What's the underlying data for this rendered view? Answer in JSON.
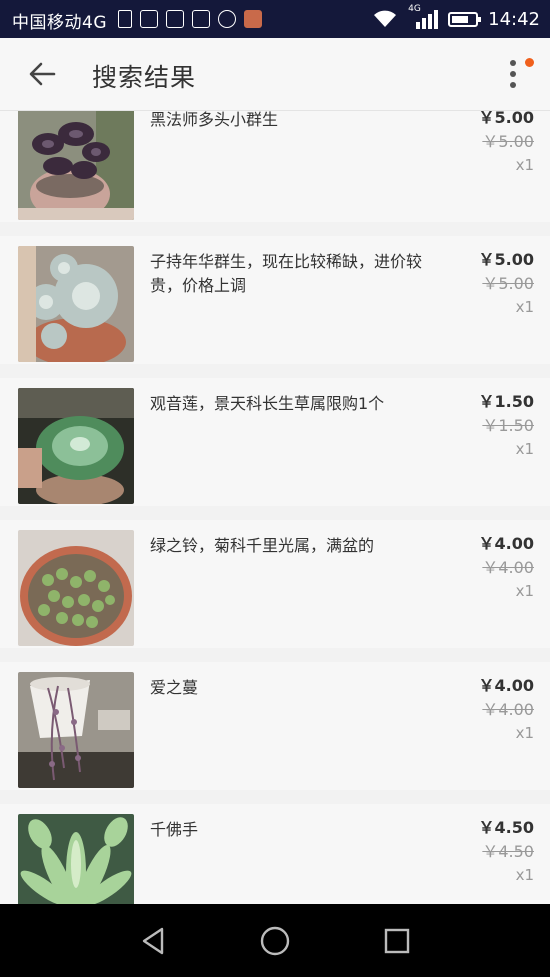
{
  "status_bar": {
    "carrier": "中国移动4G",
    "time": "14:42",
    "network": "4G",
    "icons": [
      "sim-alert-icon",
      "taobao-icon",
      "douguo-icon",
      "douguo-icon",
      "vpn-icon",
      "app-icon"
    ]
  },
  "header": {
    "title": "搜索结果"
  },
  "items": [
    {
      "name": "黑法师多头小群生",
      "price": "￥5.00",
      "original_price": "￥5.00",
      "quantity": "x1",
      "image": "dark-rosette-succulent"
    },
    {
      "name": "子持年华群生，现在比较稀缺，进价较贵，价格上调",
      "price": "￥5.00",
      "original_price": "￥5.00",
      "quantity": "x1",
      "image": "pale-blue-rosette-succulent"
    },
    {
      "name": "观音莲，景天科长生草属限购1个",
      "price": "￥1.50",
      "original_price": "￥1.50",
      "quantity": "x1",
      "image": "green-rosette-succulent"
    },
    {
      "name": "绿之铃，菊科千里光属，满盆的",
      "price": "￥4.00",
      "original_price": "￥4.00",
      "quantity": "x1",
      "image": "string-of-pearls-pot"
    },
    {
      "name": "爱之蔓",
      "price": "￥4.00",
      "original_price": "￥4.00",
      "quantity": "x1",
      "image": "string-of-hearts-white-pot"
    },
    {
      "name": "千佛手",
      "price": "￥4.50",
      "original_price": "￥4.50",
      "quantity": "x1",
      "image": "sedum-fingers"
    }
  ],
  "colors": {
    "status_bar": "#14183a",
    "notification_dot": "#f0601c",
    "page_background": "#f2f2f2"
  }
}
